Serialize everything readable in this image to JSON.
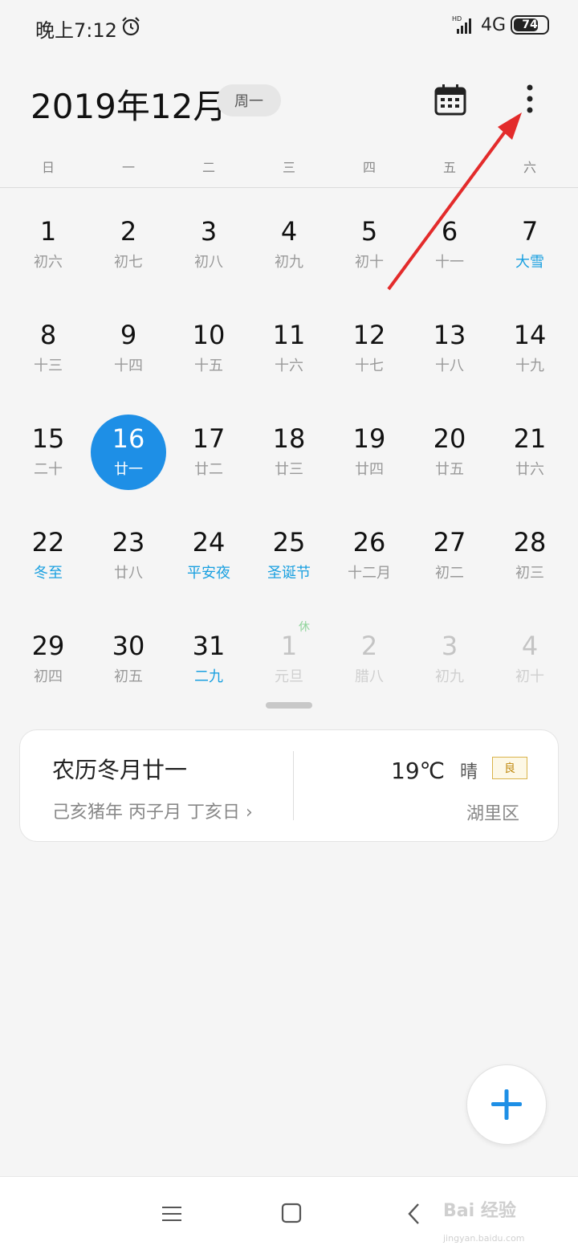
{
  "status_bar": {
    "time": "晚上7:12",
    "network": "4G",
    "battery": "74",
    "battery_level": 0.74,
    "icons": [
      "alarm-clock-icon",
      "hd-signal-icon",
      "battery-icon"
    ]
  },
  "header": {
    "month_title": "2019年12月",
    "week_start_chip": "周一",
    "icons": [
      "calendar-icon",
      "more-vertical-icon"
    ]
  },
  "weekdays": [
    "日",
    "一",
    "二",
    "三",
    "四",
    "五",
    "六"
  ],
  "calendar": {
    "days": [
      {
        "day": "1",
        "lunar": "初六"
      },
      {
        "day": "2",
        "lunar": "初七"
      },
      {
        "day": "3",
        "lunar": "初八"
      },
      {
        "day": "4",
        "lunar": "初九"
      },
      {
        "day": "5",
        "lunar": "初十"
      },
      {
        "day": "6",
        "lunar": "十一"
      },
      {
        "day": "7",
        "lunar": "大雪",
        "festival": true
      },
      {
        "day": "8",
        "lunar": "十三"
      },
      {
        "day": "9",
        "lunar": "十四"
      },
      {
        "day": "10",
        "lunar": "十五"
      },
      {
        "day": "11",
        "lunar": "十六"
      },
      {
        "day": "12",
        "lunar": "十七"
      },
      {
        "day": "13",
        "lunar": "十八"
      },
      {
        "day": "14",
        "lunar": "十九"
      },
      {
        "day": "15",
        "lunar": "二十"
      },
      {
        "day": "16",
        "lunar": "廿一",
        "today": true
      },
      {
        "day": "17",
        "lunar": "廿二"
      },
      {
        "day": "18",
        "lunar": "廿三"
      },
      {
        "day": "19",
        "lunar": "廿四"
      },
      {
        "day": "20",
        "lunar": "廿五"
      },
      {
        "day": "21",
        "lunar": "廿六"
      },
      {
        "day": "22",
        "lunar": "冬至",
        "festival": true
      },
      {
        "day": "23",
        "lunar": "廿八"
      },
      {
        "day": "24",
        "lunar": "平安夜",
        "festival": true
      },
      {
        "day": "25",
        "lunar": "圣诞节",
        "festival": true
      },
      {
        "day": "26",
        "lunar": "十二月"
      },
      {
        "day": "27",
        "lunar": "初二"
      },
      {
        "day": "28",
        "lunar": "初三"
      },
      {
        "day": "29",
        "lunar": "初四"
      },
      {
        "day": "30",
        "lunar": "初五"
      },
      {
        "day": "31",
        "lunar": "二九",
        "festival": true
      },
      {
        "day": "1",
        "lunar": "元旦",
        "other_month": true,
        "holiday_badge": "休"
      },
      {
        "day": "2",
        "lunar": "腊八",
        "other_month": true
      },
      {
        "day": "3",
        "lunar": "初九",
        "other_month": true
      },
      {
        "day": "4",
        "lunar": "初十",
        "other_month": true
      }
    ]
  },
  "info_card": {
    "lunar_date": "农历冬月廿一",
    "ganzhi": "己亥猪年 丙子月 丁亥日 ›",
    "temperature": "19℃",
    "weather": "晴",
    "aqi": "良",
    "district": "湖里区"
  },
  "fab": {
    "icon": "plus-icon"
  },
  "nav_bar": {
    "icons": [
      "menu-icon",
      "home-square-icon",
      "back-icon"
    ]
  },
  "watermark": {
    "text": "Bai 经验",
    "sub": "jingyan.baidu.com"
  },
  "colors": {
    "accent": "#1e8fe6",
    "festival": "#1aa0e0",
    "annotation_arrow": "#e32b2b"
  }
}
